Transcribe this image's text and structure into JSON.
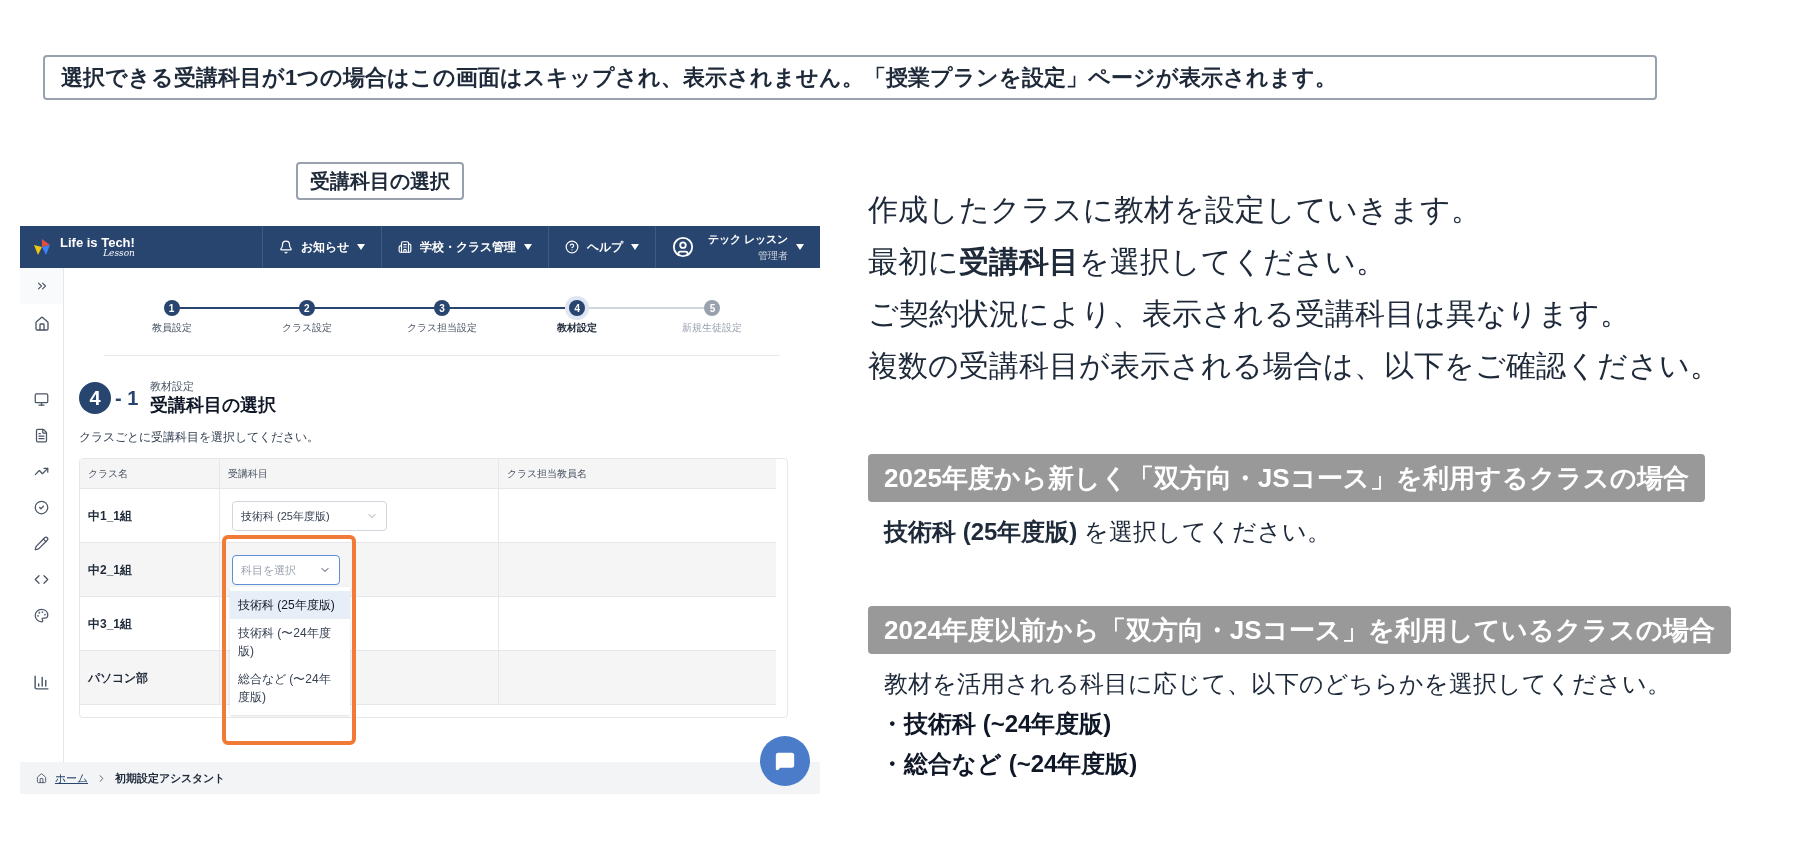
{
  "notice": "選択できる受講科目が1つの場合はこの画面はスキップされ、表示されません。「授業プランを設定」ページが表示されます。",
  "screenshot_caption": "受講科目の選択",
  "app": {
    "logo": {
      "title": "Life is Tech!",
      "subtitle": "Lesson"
    },
    "nav": [
      {
        "kind": "bell",
        "label": "お知らせ"
      },
      {
        "kind": "building",
        "label": "学校・クラス管理"
      },
      {
        "kind": "help",
        "label": "ヘルプ"
      }
    ],
    "user": {
      "name": "テック レッスン",
      "role": "管理者"
    },
    "steps": [
      {
        "number": "1",
        "label": "教員設定",
        "completed": true,
        "selected": false
      },
      {
        "number": "2",
        "label": "クラス設定",
        "completed": true,
        "selected": false
      },
      {
        "number": "3",
        "label": "クラス担当設定",
        "completed": true,
        "selected": false
      },
      {
        "number": "4",
        "label": "教材設定",
        "completed": true,
        "selected": true
      },
      {
        "number": "5",
        "label": "新規生徒設定",
        "completed": false,
        "selected": false
      }
    ],
    "section": {
      "number": "4",
      "suffix": "- 1",
      "category": "教材設定",
      "title": "受講科目の選択",
      "description": "クラスごとに受講科目を選択してください。"
    },
    "table": {
      "columns": [
        "クラス名",
        "受講科目",
        "クラス担当教員名"
      ],
      "rows": [
        {
          "name": "中1_1組",
          "subject": {
            "kind": "filled",
            "text": "技術科 (25年度版)"
          }
        },
        {
          "name": "中2_1組",
          "subject": {
            "kind": "open",
            "placeholder": "科目を選択"
          }
        },
        {
          "name": "中3_1組"
        },
        {
          "name": "パソコン部"
        }
      ]
    },
    "dropdown_options": [
      {
        "label": "技術科 (25年度版)",
        "highlighted": true
      },
      {
        "label": "技術科 (〜24年度版)",
        "highlighted": false
      },
      {
        "label": "総合など (〜24年度版)",
        "highlighted": false
      }
    ],
    "breadcrumb": [
      {
        "label": "ホーム",
        "link": true
      },
      {
        "label": "初期設定アシスタント",
        "link": false
      }
    ]
  },
  "intro": [
    "作成したクラスに教材を設定していきます。",
    "最初に**受講科目**を選択してください。",
    "ご契約状況により、表示される受講科目は異なります。",
    "複数の受講科目が表示される場合は、以下をご確認ください。"
  ],
  "cases": [
    {
      "heading": "2025年度から新しく「双方向・JSコース」を利用するクラスの場合",
      "body": "**技術科 (25年度版)** を選択してください。"
    },
    {
      "heading": "2024年度以前から「双方向・JSコース」を利用しているクラスの場合",
      "body": "教材を活用される科目に応じて、以下のどちらかを選択してください。",
      "options": [
        "・技術科 (~24年度版)",
        "・総合など (~24年度版)"
      ]
    }
  ]
}
